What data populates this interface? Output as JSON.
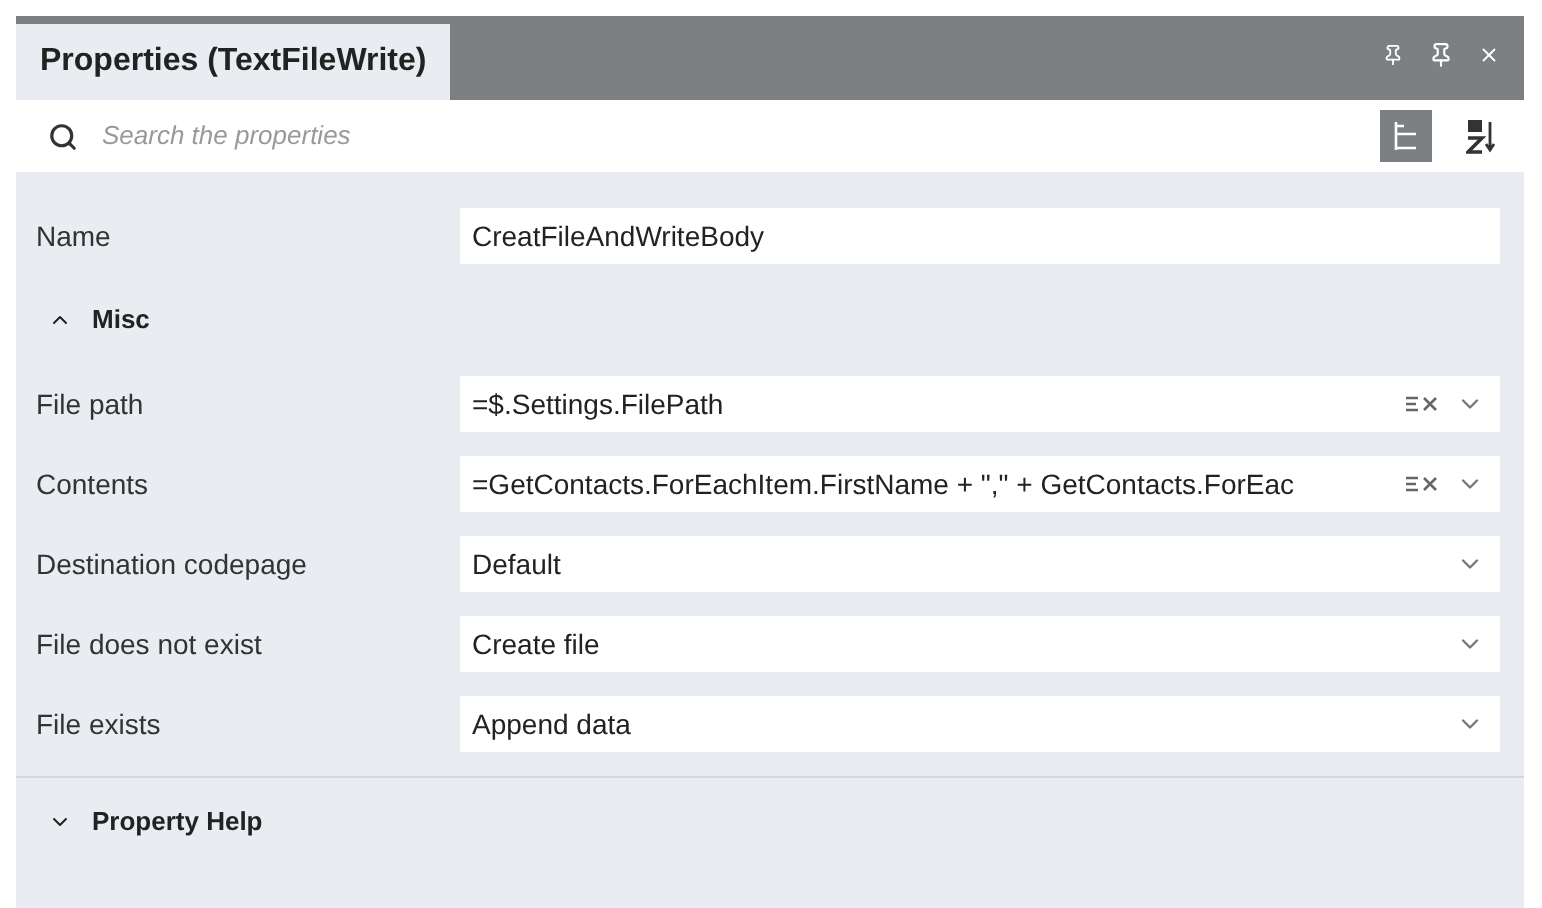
{
  "panel": {
    "title": "Properties (TextFileWrite)",
    "search": {
      "placeholder": "Search the properties"
    },
    "view_buttons": [
      {
        "kind": "categorized",
        "selected": true
      },
      {
        "kind": "alphabetical",
        "selected": false
      }
    ]
  },
  "top_property": {
    "label": "Name",
    "value": "CreatFileAndWriteBody"
  },
  "sections": [
    {
      "title": "Misc",
      "expanded": true,
      "properties": [
        {
          "label": "File path",
          "value": "=$.Settings.FilePath",
          "kind": "expression"
        },
        {
          "label": "Contents",
          "value": "=GetContacts.ForEachItem.FirstName + \",\" + GetContacts.ForEac",
          "kind": "expression"
        },
        {
          "label": "Destination codepage",
          "value": "Default",
          "kind": "dropdown"
        },
        {
          "label": "File does not exist",
          "value": "Create file",
          "kind": "dropdown"
        },
        {
          "label": "File exists",
          "value": "Append data",
          "kind": "dropdown"
        }
      ]
    },
    {
      "title": "Property Help",
      "expanded": false
    }
  ]
}
